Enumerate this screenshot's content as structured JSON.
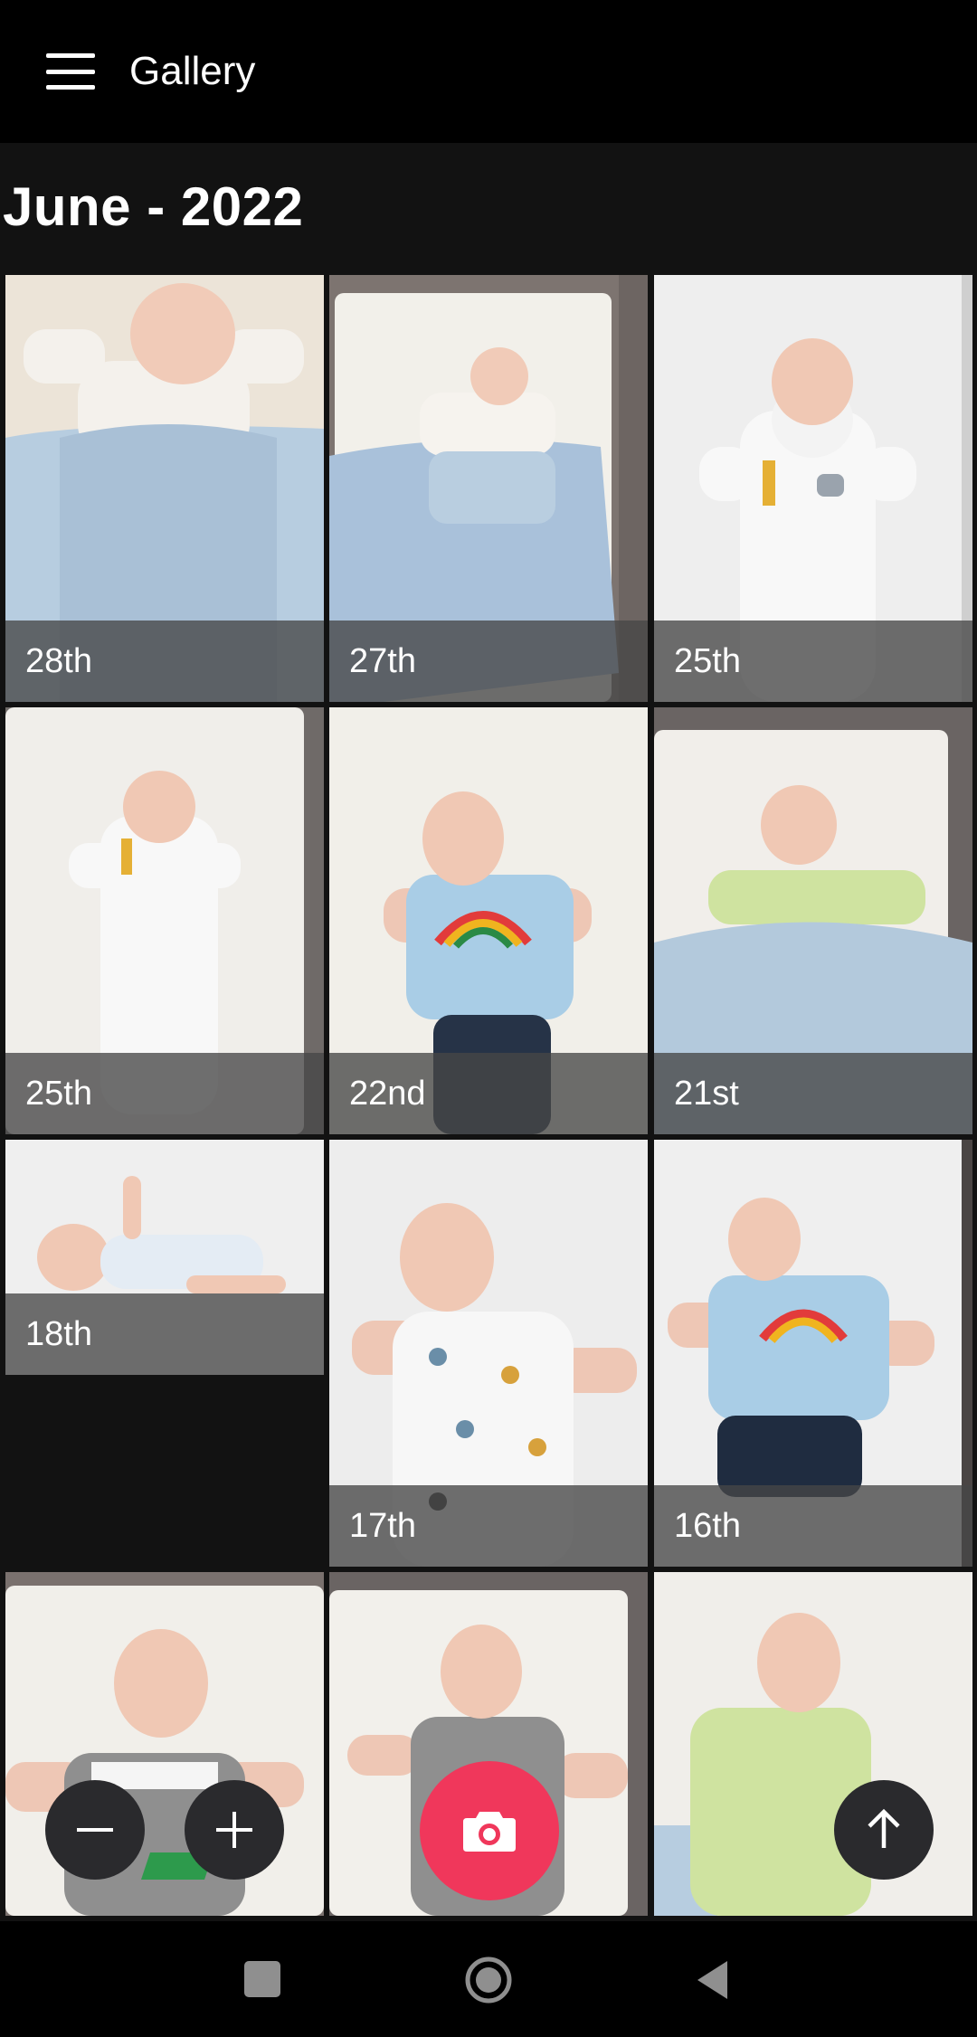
{
  "app_bar": {
    "title": "Gallery",
    "menu_icon": "hamburger-menu-icon"
  },
  "section": {
    "title": "June - 2022"
  },
  "photos": [
    {
      "label": "28th",
      "scene": "blanket-cream"
    },
    {
      "label": "27th",
      "scene": "cot-blanket"
    },
    {
      "label": "25th",
      "scene": "bib-white"
    },
    {
      "label": "25th",
      "scene": "bib-white-cot"
    },
    {
      "label": "22nd",
      "scene": "rainbow-shirt"
    },
    {
      "label": "21st",
      "scene": "green-blanket"
    },
    {
      "label": "18th",
      "scene": "sideways-bodysuit"
    },
    {
      "label": "17th",
      "scene": "animal-print"
    },
    {
      "label": "16th",
      "scene": "rainbow-shorts"
    },
    {
      "label": "",
      "scene": "grey-dungarees"
    },
    {
      "label": "",
      "scene": "grey-dungarees-cot"
    },
    {
      "label": "",
      "scene": "green-sleepsuit"
    }
  ],
  "fabs": {
    "zoom_out_icon": "minus-icon",
    "zoom_in_icon": "plus-icon",
    "camera_icon": "camera-icon",
    "scroll_top_icon": "arrow-up-icon"
  },
  "colors": {
    "camera_fab": "#f0375b",
    "app_bar": "#000000",
    "background": "#121212"
  },
  "system_nav": {
    "icons": [
      "recents-square-icon",
      "home-circle-icon",
      "back-triangle-icon"
    ]
  }
}
